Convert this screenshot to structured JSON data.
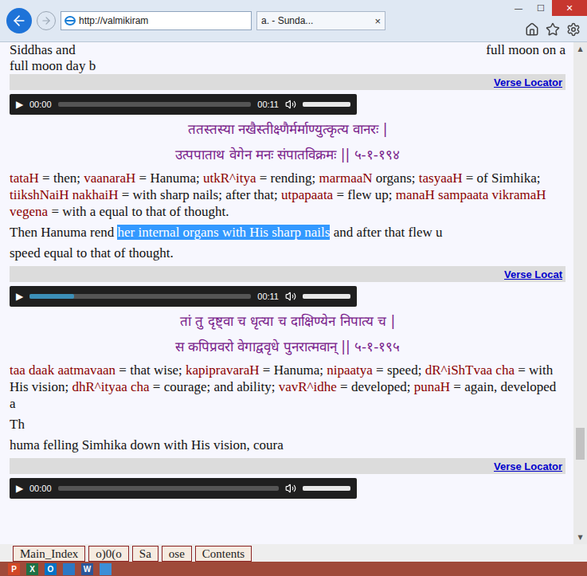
{
  "browser": {
    "address": "http://valmikiram",
    "tab": "a. - Sunda...",
    "tab_close": "×",
    "window_buttons": [
      {
        "label": "—",
        "kind": "normal"
      },
      {
        "label": "☐",
        "kind": "normal"
      },
      {
        "label": "✕",
        "kind": "close"
      }
    ]
  },
  "intro": {
    "left": "Siddhas and",
    "right": "full moon on a",
    "next": "full moon day b"
  },
  "verses": [
    {
      "locator": "Verse Locator",
      "player": {
        "icon": "▶",
        "time": "00:00",
        "duration": "00:11",
        "level": 0,
        "volume": 1
      },
      "sanskrit": [
        "ततस्तस्या नखैस्तीक्ष्णैर्मर्माण्युत्कृत्य वानरः |",
        "उत्पपाताथ वेगेन मनः संपातविक्रमः || ५-१-१९४"
      ],
      "meaning": [
        {
          "text": "tataH",
          "term": true
        },
        {
          "text": " = then; ",
          "term": false
        },
        {
          "text": "vaanaraH",
          "term": true
        },
        {
          "text": " = Hanuma; ",
          "term": false
        },
        {
          "text": "utkR^itya",
          "term": true
        },
        {
          "text": " = rending; ",
          "term": false
        },
        {
          "text": "marmaaN",
          "term": true
        },
        {
          "text": " organs; ",
          "term": false
        },
        {
          "text": "tasyaaH",
          "term": true
        },
        {
          "text": " = of Simhika; ",
          "term": false
        },
        {
          "text": "tiikshNaiH nakhaiH",
          "term": true
        },
        {
          "text": " = with sharp nails; ",
          "term": false
        },
        {
          "text": "after that; ",
          "term": false
        },
        {
          "text": "utpapaata",
          "term": true
        },
        {
          "text": " = flew up; ",
          "term": false
        },
        {
          "text": "manaH sampaata vikramaH vegena",
          "term": true
        },
        {
          "text": " = with a ",
          "term": false
        },
        {
          "text": "equal to that of thought.",
          "term": false
        }
      ],
      "translation": [
        [
          {
            "text": "Then Hanuma rend ",
            "highlighted": false
          },
          {
            "text": "her internal organs with His sharp nails",
            "highlighted": true
          },
          {
            "text": " and after that flew u",
            "highlighted": false
          }
        ],
        [
          {
            "text": "speed equal to that of thought.",
            "highlighted": false
          }
        ]
      ]
    },
    {
      "locator": "Verse Locat",
      "player": {
        "icon": "▶",
        "time": null,
        "duration": "00:11",
        "level": 0.2,
        "volume": 1
      },
      "sanskrit": [
        "तां तु दृष्ट्वा च धृत्या च दाक्षिण्येन निपात्य च |",
        "स कपिप्रवरो वेगाद्ववृधे पुनरात्मवान् || ५-१-१९५"
      ],
      "meaning": [
        {
          "text": "taa",
          "term": true
        },
        {
          "text": " ",
          "term": false
        },
        {
          "text": "daak",
          "term": true
        },
        {
          "text": " ",
          "term": false
        },
        {
          "text": "aatmavaan",
          "term": true
        },
        {
          "text": " = that wise; ",
          "term": false
        },
        {
          "text": "kapipravaraH",
          "term": true
        },
        {
          "text": " = Hanuma; ",
          "term": false
        },
        {
          "text": "nipaatya",
          "term": true
        },
        {
          "text": " = ",
          "term": false
        },
        {
          "text": "speed; ",
          "term": false
        },
        {
          "text": "dR^iShTvaa cha",
          "term": true
        },
        {
          "text": " = with His vision; ",
          "term": false
        },
        {
          "text": "dhR^ityaa cha",
          "term": true
        },
        {
          "text": " = courage; ",
          "term": false
        },
        {
          "text": "and ability; ",
          "term": false
        },
        {
          "text": "vavR^idhe",
          "term": true
        },
        {
          "text": " = developed; ",
          "term": false
        },
        {
          "text": "punaH",
          "term": true
        },
        {
          "text": " = again, ",
          "term": false
        },
        {
          "text": "developed a",
          "term": false
        }
      ],
      "translation": [
        [
          {
            "text": "Th",
            "highlighted": false
          }
        ],
        [
          {
            "text": "huma felling Simhika down with His vision, coura",
            "highlighted": false
          }
        ]
      ]
    },
    {
      "locator": "Verse Locator",
      "player": {
        "icon": "▶",
        "time": "00:00",
        "duration": null,
        "level": 0,
        "volume": 1
      },
      "sanskrit": [],
      "meaning": [],
      "translation": []
    }
  ],
  "scrollbar": {
    "up": "▲",
    "down": "▼",
    "level": 0.85
  },
  "nav": [
    "Main_Index",
    "o)0(o",
    "Sa",
    "ose",
    "Contents"
  ],
  "taskbar": [
    {
      "letter": "P",
      "color": "#d24726"
    },
    {
      "letter": "X",
      "color": "#1e7145"
    },
    {
      "letter": "O",
      "color": "#0072c6"
    },
    {
      "letter": "",
      "color": "#2b78c5"
    },
    {
      "letter": "W",
      "color": "#2b579a"
    },
    {
      "letter": "",
      "color": "#3c8fd8"
    }
  ]
}
